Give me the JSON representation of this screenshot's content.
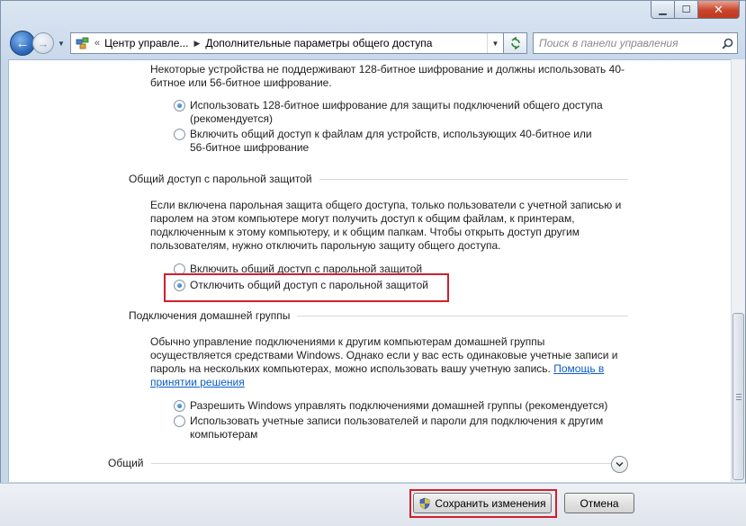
{
  "address": {
    "crumbs": [
      "Центр управле...",
      "Дополнительные параметры общего доступа"
    ]
  },
  "search": {
    "placeholder": "Поиск в панели управления"
  },
  "encryption": {
    "intro": [
      "Некоторые устройства не поддерживают 128-битное шифрование и должны использовать 40-",
      "битное или 56-битное шифрование."
    ],
    "option1": [
      "Использовать 128-битное шифрование для защиты подключений общего доступа",
      "(рекомендуется)"
    ],
    "option2": [
      "Включить общий доступ к файлам для устройств, использующих 40-битное или",
      "56-битное шифрование"
    ]
  },
  "password": {
    "heading": "Общий доступ с парольной защитой",
    "desc": [
      "Если включена парольная защита общего доступа, только пользователи с учетной записью и",
      "паролем на этом компьютере могут получить доступ к общим файлам, к принтерам,",
      "подключенным к этому компьютеру, и к общим папкам. Чтобы открыть доступ другим",
      "пользователям, нужно отключить парольную защиту общего доступа."
    ],
    "option_on": "Включить общий доступ с парольной защитой",
    "option_off": "Отключить общий доступ с парольной защитой"
  },
  "homegroup": {
    "heading": "Подключения домашней группы",
    "desc": [
      "Обычно управление подключениями к другим компьютерам домашней группы",
      "осуществляется средствами Windows. Однако если у вас есть одинаковые учетные записи и",
      "пароль на нескольких компьютерах, можно использовать вашу учетную запись."
    ],
    "help_link": [
      "Помощь в",
      "принятии решения"
    ],
    "option1": "Разрешить Windows управлять подключениями домашней группы (рекомендуется)",
    "option2": [
      "Использовать учетные записи пользователей и пароли для подключения к другим",
      "компьютерам"
    ]
  },
  "general": {
    "heading": "Общий"
  },
  "buttons": {
    "save": "Сохранить изменения",
    "cancel": "Отмена"
  }
}
